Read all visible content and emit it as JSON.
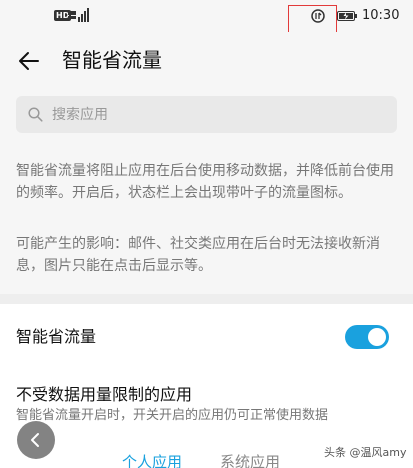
{
  "status_bar": {
    "hd_badge": "HD",
    "time": "10:30"
  },
  "app_bar": {
    "title": "智能省流量"
  },
  "search": {
    "placeholder": "搜索应用"
  },
  "description": {
    "paragraph_1": "智能省流量将阻止应用在后台使用移动数据，并降低前台使用的频率。开启后，状态栏上会出现带叶子的流量图标。",
    "paragraph_2": "可能产生的影响：邮件、社交类应用在后台时无法接收新消息，图片只能在点击后显示等。"
  },
  "toggle_row": {
    "label": "智能省流量",
    "enabled": true
  },
  "unrestricted_section": {
    "title": "不受数据用量限制的应用",
    "subtitle": "智能省流量开启时，开关开启的应用仍可正常使用数据"
  },
  "tabs": [
    {
      "label": "个人应用",
      "active": true
    },
    {
      "label": "系统应用",
      "active": false
    }
  ],
  "watermark": "头条 @温风amy",
  "colors": {
    "accent": "#1aa1de",
    "background": "#f6f6f6",
    "highlight": "#e23a3a"
  },
  "icons": {
    "back": "arrow-left-icon",
    "search": "search-icon",
    "data_saver": "data-saver-icon",
    "battery": "battery-icon"
  }
}
